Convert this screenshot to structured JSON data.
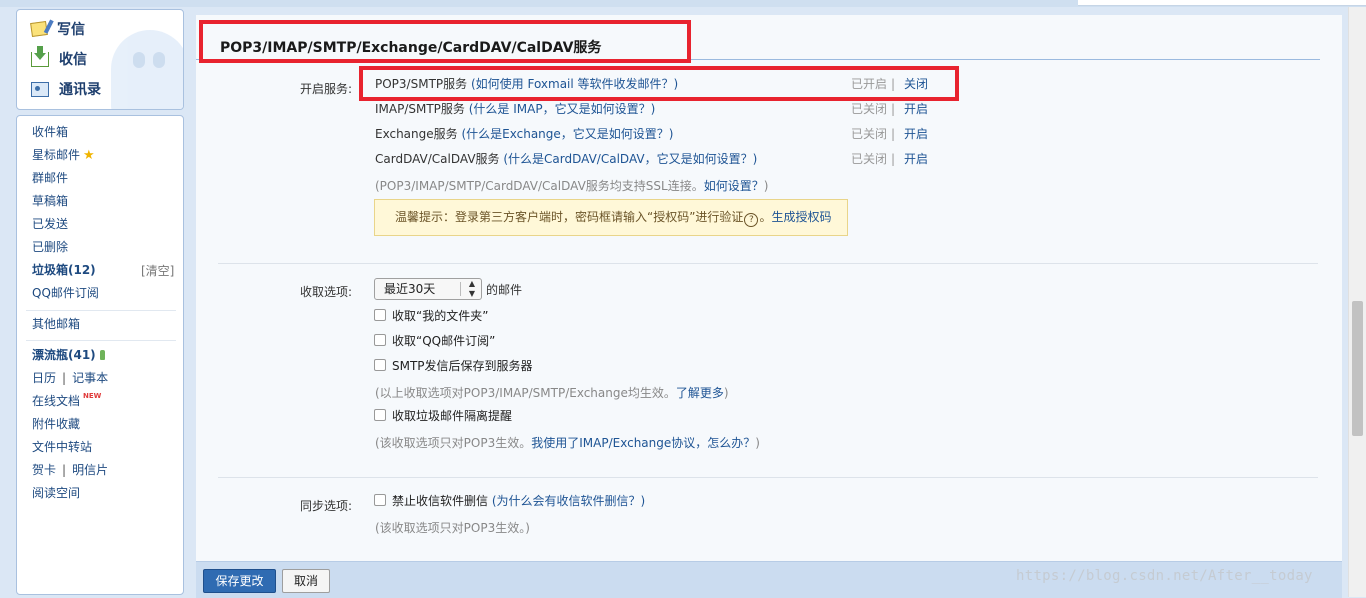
{
  "quick_actions": [
    {
      "label": "写信",
      "icon": "write-icon"
    },
    {
      "label": "收信",
      "icon": "inbox-arrow-icon"
    },
    {
      "label": "通讯录",
      "icon": "contacts-icon"
    }
  ],
  "nav": {
    "inbox": "收件箱",
    "starred": "星标邮件",
    "group": "群邮件",
    "drafts": "草稿箱",
    "sent": "已发送",
    "deleted": "已删除",
    "spam": "垃圾箱(12)",
    "spam_clear": "[清空]",
    "qq_subscribe": "QQ邮件订阅",
    "other_mailboxes": "其他邮箱",
    "drift_bottle": "漂流瓶(41)",
    "calendar": "日历",
    "notes": "记事本",
    "pipe": "|",
    "online_docs": "在线文档",
    "new_badge": "NEW",
    "attachments": "附件收藏",
    "file_transfer": "文件中转站",
    "greeting_card": "贺卡",
    "postcard": "明信片",
    "reading_space": "阅读空间"
  },
  "section": {
    "title": "POP3/IMAP/SMTP/Exchange/CardDAV/CalDAV服务"
  },
  "services": {
    "label": "开启服务:",
    "items": [
      {
        "name": "POP3/SMTP服务",
        "help": "(如何使用 Foxmail 等软件收发邮件？)",
        "status": "已开启",
        "action": "关闭"
      },
      {
        "name": "IMAP/SMTP服务",
        "help": "(什么是 IMAP，它又是如何设置？)",
        "status": "已关闭",
        "action": "开启"
      },
      {
        "name": "Exchange服务",
        "help": "(什么是Exchange，它又是如何设置？)",
        "status": "已关闭",
        "action": "开启"
      },
      {
        "name": "CardDAV/CalDAV服务",
        "help": "(什么是CardDAV/CalDAV，它又是如何设置？)",
        "status": "已关闭",
        "action": "开启"
      }
    ],
    "separator": "|",
    "ssl_note_prefix": "(POP3/IMAP/SMTP/CardDAV/CalDAV服务均支持SSL连接。",
    "ssl_note_link": "如何设置？",
    "ssl_note_suffix": ")",
    "tip_text": "温馨提示：登录第三方客户端时，密码框请输入“授权码”进行验证",
    "tip_q": "?",
    "tip_dot": "。",
    "tip_link": "生成授权码"
  },
  "receive": {
    "label": "收取选项:",
    "range_value": "最近30天",
    "range_suffix": "的邮件",
    "opt_my_folders": "收取“我的文件夹”",
    "opt_qq_subscribe": "收取“QQ邮件订阅”",
    "opt_smtp_save": "SMTP发信后保存到服务器",
    "note1_prefix": "(以上收取选项对POP3/IMAP/SMTP/Exchange均生效。",
    "note1_link": "了解更多",
    "note1_suffix": ")",
    "opt_spam_isolation": "收取垃圾邮件隔离提醒",
    "note2_prefix": "(该收取选项只对POP3生效。",
    "note2_link": "我使用了IMAP/Exchange协议，怎么办？",
    "note2_suffix": ")"
  },
  "sync": {
    "label": "同步选项:",
    "opt_no_delete": "禁止收信软件删信",
    "opt_no_delete_help": "(为什么会有收信软件删信？)",
    "note": "(该收取选项只对POP3生效。)"
  },
  "actions": {
    "save": "保存更改",
    "cancel": "取消"
  },
  "watermark": "https://blog.csdn.net/After__today",
  "colors": {
    "highlight_red": "#e8232f",
    "primary_button": "#2f6bb2",
    "link": "#1e5494"
  }
}
